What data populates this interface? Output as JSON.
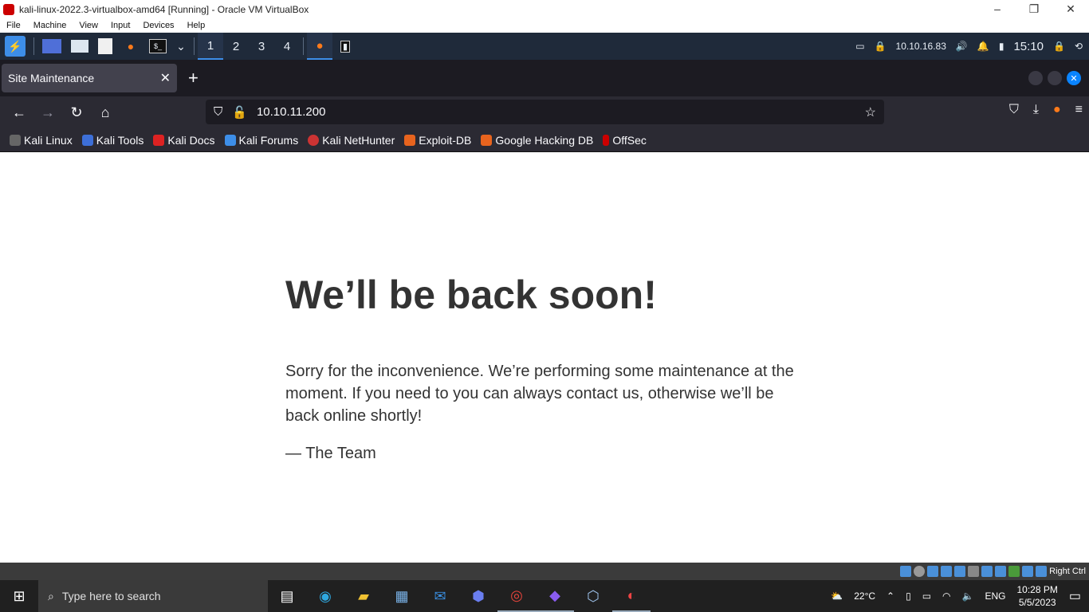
{
  "vbox": {
    "title": "kali-linux-2022.3-virtualbox-amd64 [Running] - Oracle VM VirtualBox",
    "menu": [
      "File",
      "Machine",
      "View",
      "Input",
      "Devices",
      "Help"
    ],
    "status_right": "Right Ctrl"
  },
  "kali": {
    "workspaces": [
      "1",
      "2",
      "3",
      "4"
    ],
    "ip": "10.10.16.83",
    "clock": "15:10"
  },
  "browser": {
    "tab_title": "Site Maintenance",
    "url": "10.10.11.200",
    "bookmarks": [
      "Kali Linux",
      "Kali Tools",
      "Kali Docs",
      "Kali Forums",
      "Kali NetHunter",
      "Exploit-DB",
      "Google Hacking DB",
      "OffSec"
    ]
  },
  "page": {
    "heading": "We’ll be back soon!",
    "body": "Sorry for the inconvenience. We’re performing some maintenance at the moment. If you need to you can always contact us, otherwise we’ll be back online shortly!",
    "signature": "— The Team"
  },
  "taskbar": {
    "search_placeholder": "Type here to search",
    "weather": "22°C",
    "language": "ENG",
    "time": "10:28 PM",
    "date": "5/5/2023"
  }
}
